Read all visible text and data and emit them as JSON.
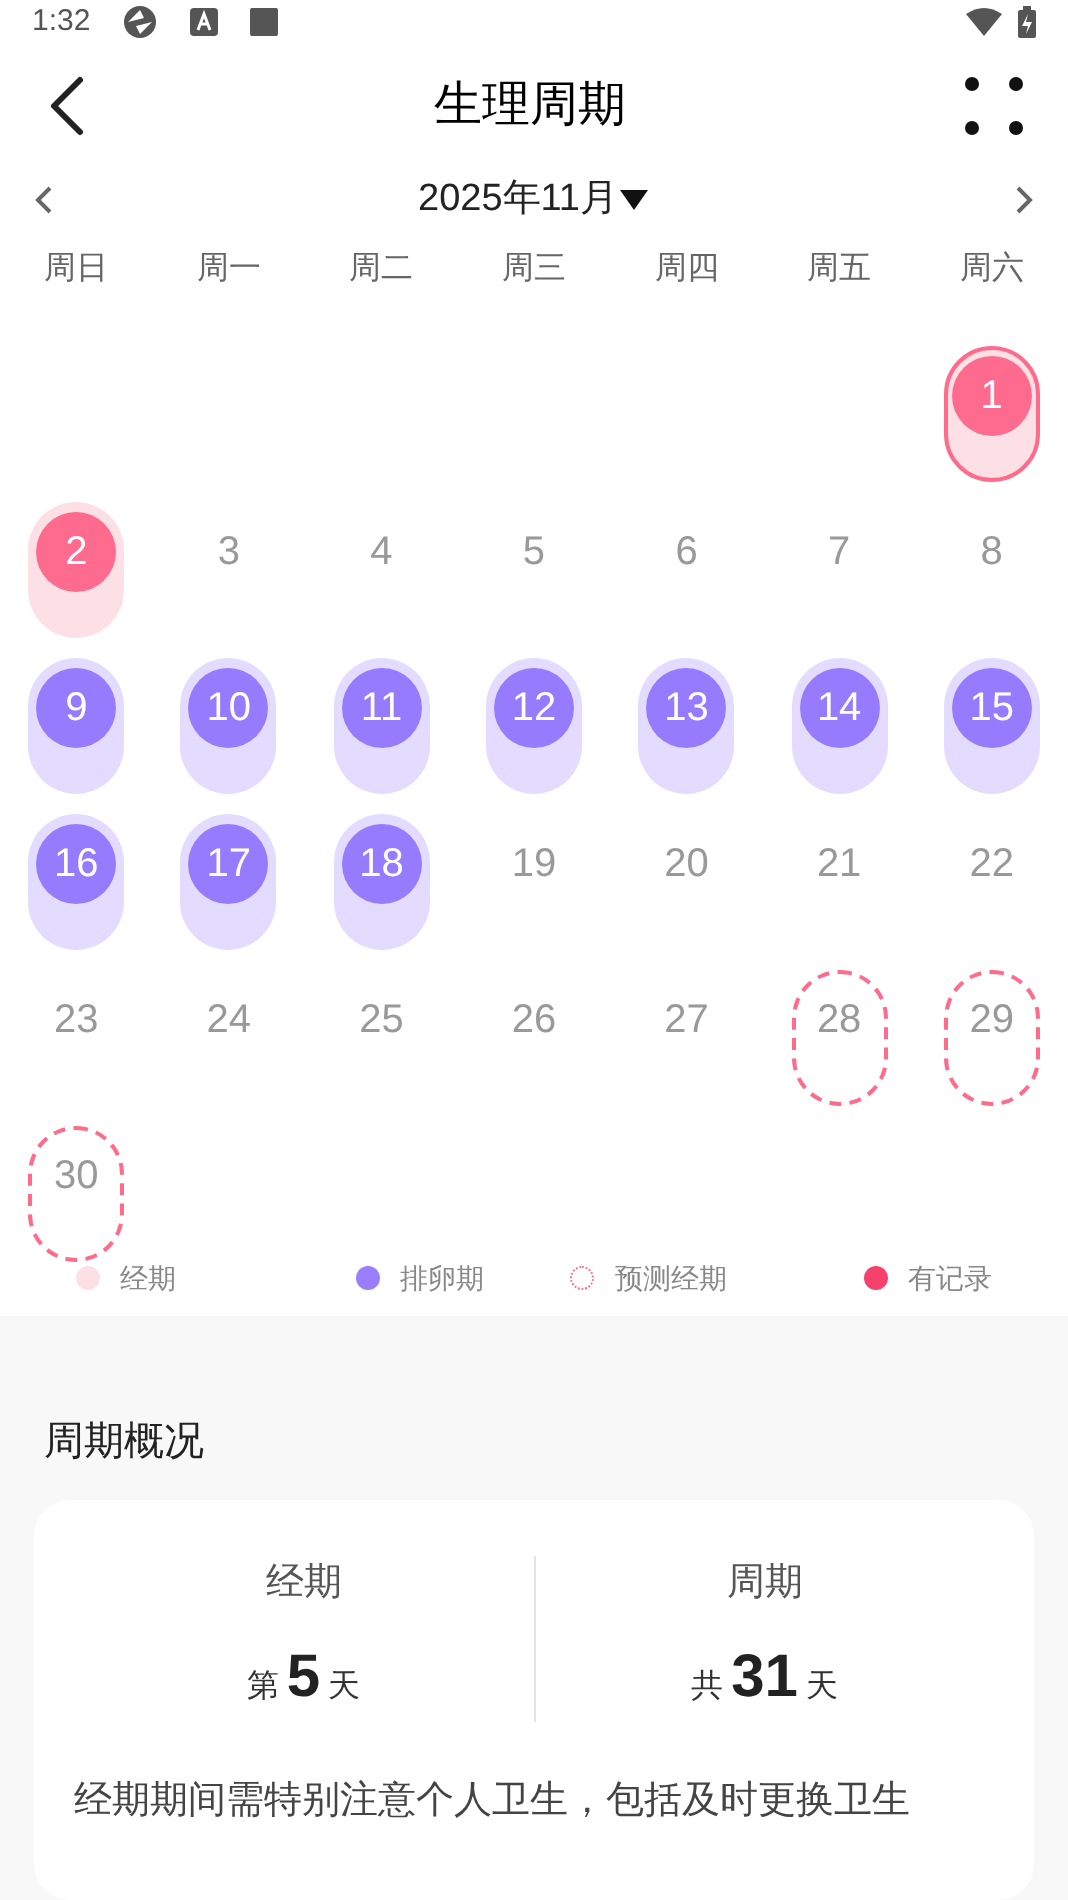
{
  "status_bar": {
    "time": "1:32"
  },
  "header": {
    "title": "生理周期"
  },
  "month_nav": {
    "label": "2025年11月"
  },
  "weekdays": [
    "周日",
    "周一",
    "周二",
    "周三",
    "周四",
    "周五",
    "周六"
  ],
  "weeks": [
    [
      {
        "kind": "empty"
      },
      {
        "kind": "empty"
      },
      {
        "kind": "empty"
      },
      {
        "kind": "empty"
      },
      {
        "kind": "empty"
      },
      {
        "kind": "empty"
      },
      {
        "kind": "period",
        "day": "1",
        "selected": true
      }
    ],
    [
      {
        "kind": "period",
        "day": "2",
        "selected": false
      },
      {
        "kind": "normal",
        "day": "3",
        "selected": false
      },
      {
        "kind": "normal",
        "day": "4",
        "selected": false
      },
      {
        "kind": "normal",
        "day": "5",
        "selected": false
      },
      {
        "kind": "normal",
        "day": "6",
        "selected": false
      },
      {
        "kind": "normal",
        "day": "7",
        "selected": false
      },
      {
        "kind": "normal",
        "day": "8",
        "selected": false
      }
    ],
    [
      {
        "kind": "ovulation",
        "day": "9",
        "selected": false
      },
      {
        "kind": "ovulation",
        "day": "10",
        "selected": false
      },
      {
        "kind": "ovulation",
        "day": "11",
        "selected": false
      },
      {
        "kind": "ovulation",
        "day": "12",
        "selected": false
      },
      {
        "kind": "ovulation",
        "day": "13",
        "selected": false
      },
      {
        "kind": "ovulation",
        "day": "14",
        "selected": false
      },
      {
        "kind": "ovulation",
        "day": "15",
        "selected": false
      }
    ],
    [
      {
        "kind": "ovulation",
        "day": "16",
        "selected": false
      },
      {
        "kind": "ovulation",
        "day": "17",
        "selected": false
      },
      {
        "kind": "ovulation",
        "day": "18",
        "selected": false
      },
      {
        "kind": "normal",
        "day": "19",
        "selected": false
      },
      {
        "kind": "normal",
        "day": "20",
        "selected": false
      },
      {
        "kind": "normal",
        "day": "21",
        "selected": false
      },
      {
        "kind": "normal",
        "day": "22",
        "selected": false
      }
    ],
    [
      {
        "kind": "normal",
        "day": "23",
        "selected": false
      },
      {
        "kind": "normal",
        "day": "24",
        "selected": false
      },
      {
        "kind": "normal",
        "day": "25",
        "selected": false
      },
      {
        "kind": "normal",
        "day": "26",
        "selected": false
      },
      {
        "kind": "normal",
        "day": "27",
        "selected": false
      },
      {
        "kind": "predicted",
        "day": "28",
        "selected": false
      },
      {
        "kind": "predicted",
        "day": "29",
        "selected": false
      }
    ],
    [
      {
        "kind": "predicted",
        "day": "30",
        "selected": false
      }
    ]
  ],
  "legend": [
    {
      "kind": "dot",
      "label": "经期",
      "color": "#fde0e6"
    },
    {
      "kind": "dot",
      "label": "排卵期",
      "color": "#9b7dff"
    },
    {
      "kind": "dashed",
      "label": "预测经期",
      "color": "#ff6b8b"
    },
    {
      "kind": "dot",
      "label": "有记录",
      "color": "#f5416b"
    }
  ],
  "summary": {
    "title": "周期概况",
    "stats": [
      {
        "label": "经期",
        "prefix": "第",
        "value": "5",
        "suffix": "天"
      },
      {
        "label": "周期",
        "prefix": "共",
        "value": "31",
        "suffix": "天"
      }
    ],
    "note": "经期期间需特别注意个人卫生，包括及时更换卫生"
  }
}
